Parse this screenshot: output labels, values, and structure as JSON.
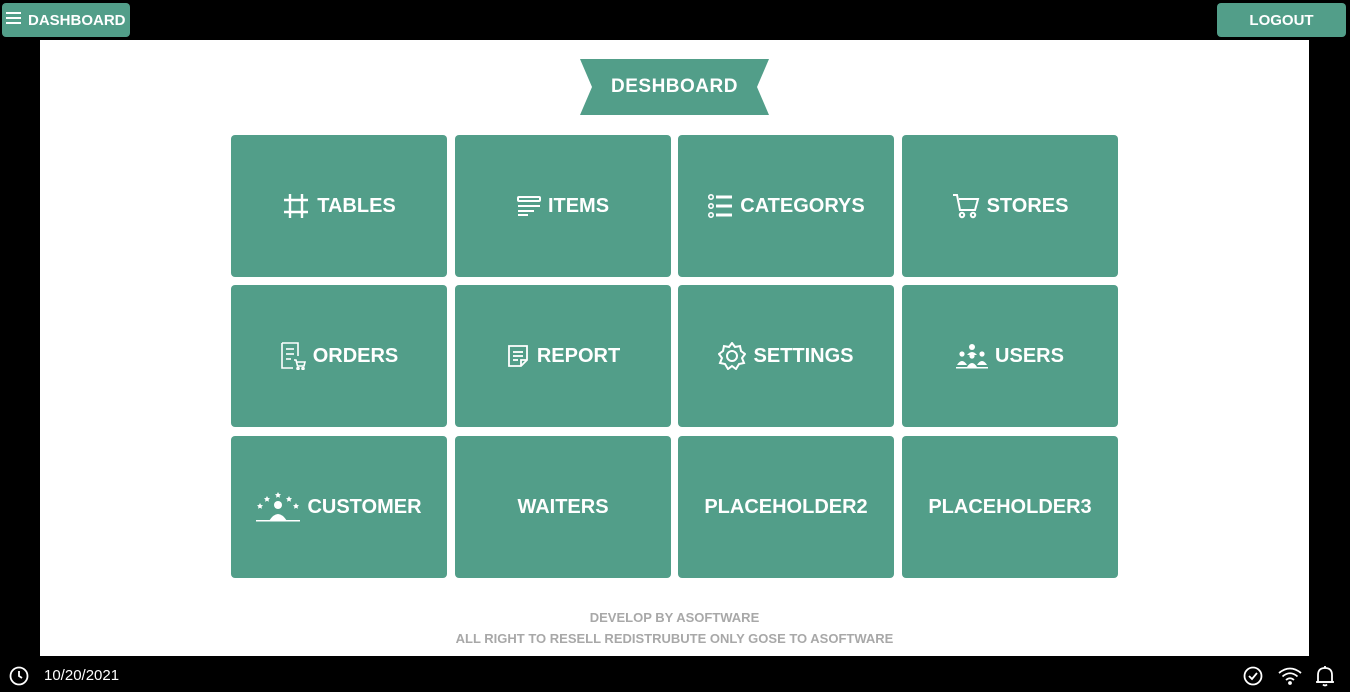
{
  "header": {
    "menu_label": "DASHBOARD",
    "logout_label": "LOGOUT"
  },
  "page": {
    "title": "DESHBOARD"
  },
  "tiles": [
    {
      "label": "TABLES",
      "icon": "table-grid-icon"
    },
    {
      "label": "ITEMS",
      "icon": "list-lines-icon"
    },
    {
      "label": "CATEGORYS",
      "icon": "category-list-icon"
    },
    {
      "label": "STORES",
      "icon": "cart-icon"
    },
    {
      "label": "ORDERS",
      "icon": "receipt-cart-icon"
    },
    {
      "label": "REPORT",
      "icon": "report-doc-icon"
    },
    {
      "label": "SETTINGS",
      "icon": "gear-icon"
    },
    {
      "label": "USERS",
      "icon": "users-group-icon"
    },
    {
      "label": "CUSTOMER",
      "icon": "customer-stars-icon"
    },
    {
      "label": "WAITERS",
      "icon": ""
    },
    {
      "label": "PLACEHOLDER2",
      "icon": ""
    },
    {
      "label": "PLACEHOLDER3",
      "icon": ""
    }
  ],
  "footer": {
    "line1": "DEVELOP BY ASOFTWARE",
    "line2": "ALL RIGHT TO RESELL REDISTRUBUTE ONLY GOSE TO ASOFTWARE"
  },
  "status": {
    "date": "10/20/2021",
    "icons": [
      "clock-icon",
      "check-circle-icon",
      "wifi-icon",
      "bell-icon"
    ]
  },
  "colors": {
    "accent": "#529e89",
    "background": "#000000",
    "panel": "#ffffff",
    "footer_text": "#a8a8a8"
  }
}
